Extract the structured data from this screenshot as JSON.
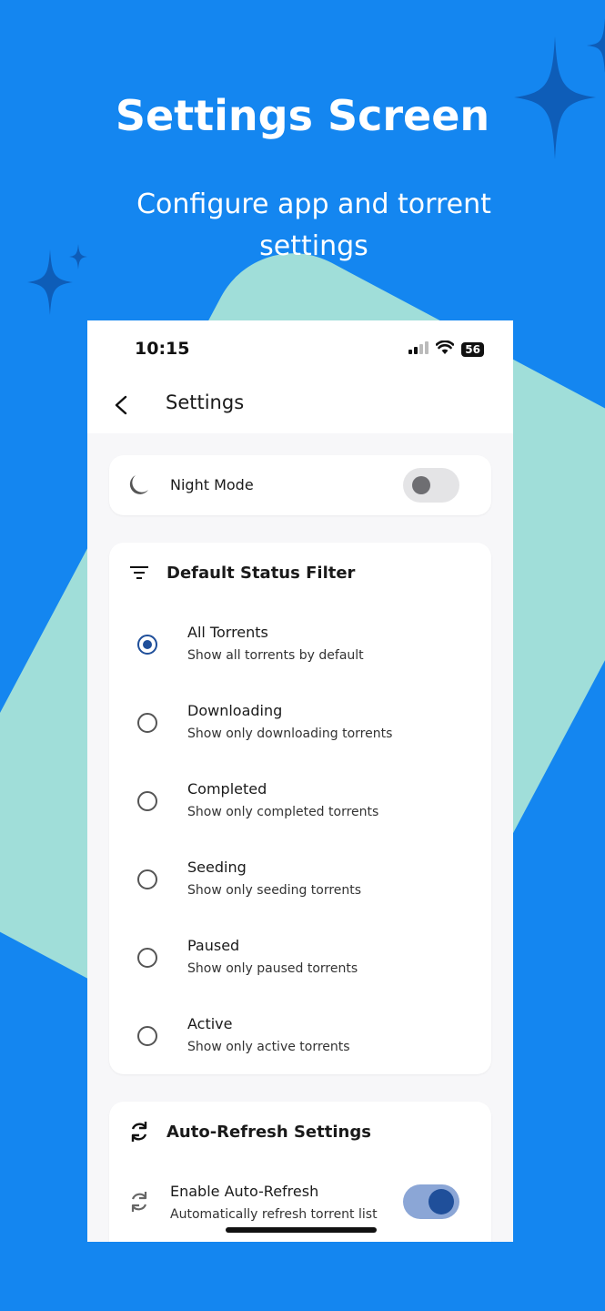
{
  "promo": {
    "title": "Settings Screen",
    "subtitle": "Configure app and torrent settings"
  },
  "colors": {
    "background": "#1486f0",
    "shape": "#a0ded9",
    "accent": "#1f4f9a"
  },
  "status_bar": {
    "time": "10:15",
    "battery": "56",
    "icons": [
      "signal-icon",
      "wifi-icon",
      "battery-icon"
    ]
  },
  "app_bar": {
    "back_icon": "back-arrow-icon",
    "title": "Settings"
  },
  "night_mode": {
    "icon": "moon-icon",
    "label": "Night Mode",
    "enabled": false
  },
  "status_filter": {
    "icon": "filter-icon",
    "title": "Default Status Filter",
    "selected": "All Torrents",
    "options": [
      {
        "title": "All Torrents",
        "subtitle": "Show all torrents by default",
        "checked": true
      },
      {
        "title": "Downloading",
        "subtitle": "Show only downloading torrents",
        "checked": false
      },
      {
        "title": "Completed",
        "subtitle": "Show only completed torrents",
        "checked": false
      },
      {
        "title": "Seeding",
        "subtitle": "Show only seeding torrents",
        "checked": false
      },
      {
        "title": "Paused",
        "subtitle": "Show only paused torrents",
        "checked": false
      },
      {
        "title": "Active",
        "subtitle": "Show only active torrents",
        "checked": false
      }
    ]
  },
  "auto_refresh": {
    "icon": "refresh-icon",
    "title": "Auto-Refresh Settings",
    "enable_label": "Enable Auto-Refresh",
    "enable_sublabel": "Automatically refresh torrent list",
    "enabled": true
  }
}
